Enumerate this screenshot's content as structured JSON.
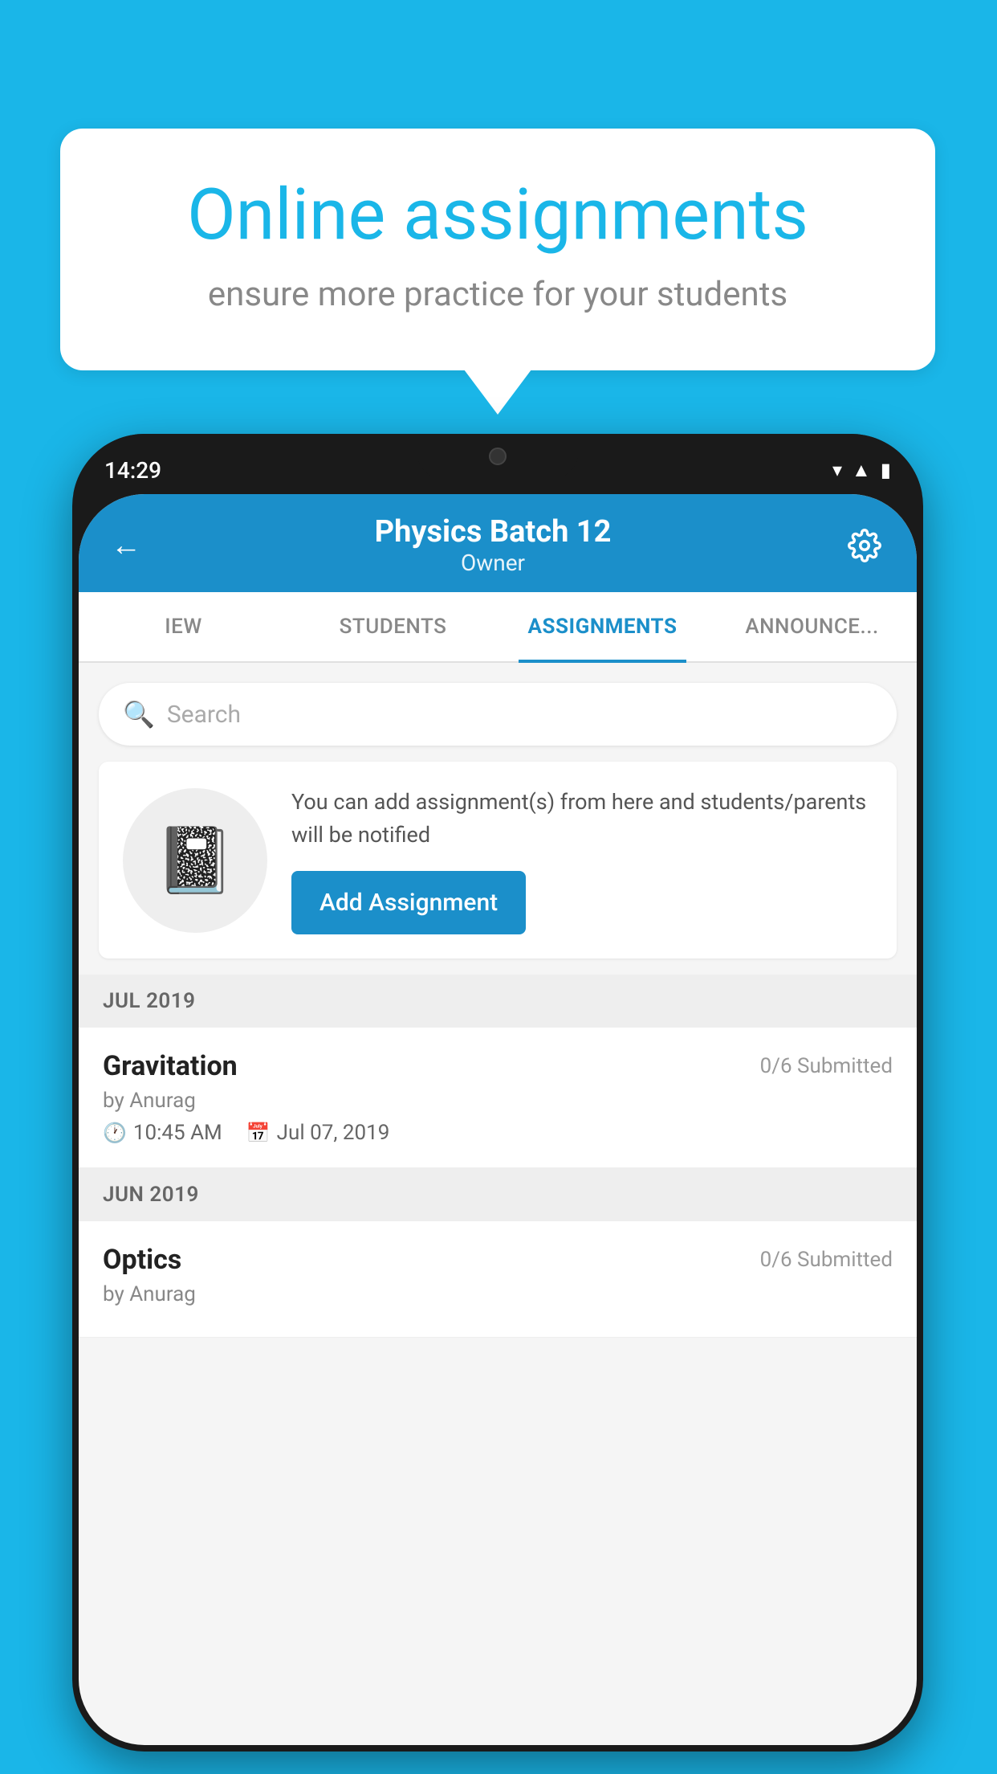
{
  "background": {
    "color": "#1ab6e8"
  },
  "speech_bubble": {
    "title": "Online assignments",
    "subtitle": "ensure more practice for your students"
  },
  "phone": {
    "status_bar": {
      "time": "14:29",
      "icons": [
        "wifi",
        "signal",
        "battery"
      ]
    },
    "header": {
      "title": "Physics Batch 12",
      "subtitle": "Owner",
      "back_label": "←",
      "settings_label": "⚙"
    },
    "tabs": [
      {
        "label": "IEW",
        "active": false
      },
      {
        "label": "STUDENTS",
        "active": false
      },
      {
        "label": "ASSIGNMENTS",
        "active": true
      },
      {
        "label": "ANNOUNCE...",
        "active": false
      }
    ],
    "search": {
      "placeholder": "Search"
    },
    "empty_state": {
      "description": "You can add assignment(s) from here and students/parents will be notified",
      "button_label": "Add Assignment"
    },
    "sections": [
      {
        "label": "JUL 2019",
        "assignments": [
          {
            "name": "Gravitation",
            "submitted": "0/6 Submitted",
            "by": "by Anurag",
            "time": "10:45 AM",
            "date": "Jul 07, 2019"
          }
        ]
      },
      {
        "label": "JUN 2019",
        "assignments": [
          {
            "name": "Optics",
            "submitted": "0/6 Submitted",
            "by": "by Anurag",
            "time": "",
            "date": ""
          }
        ]
      }
    ]
  }
}
